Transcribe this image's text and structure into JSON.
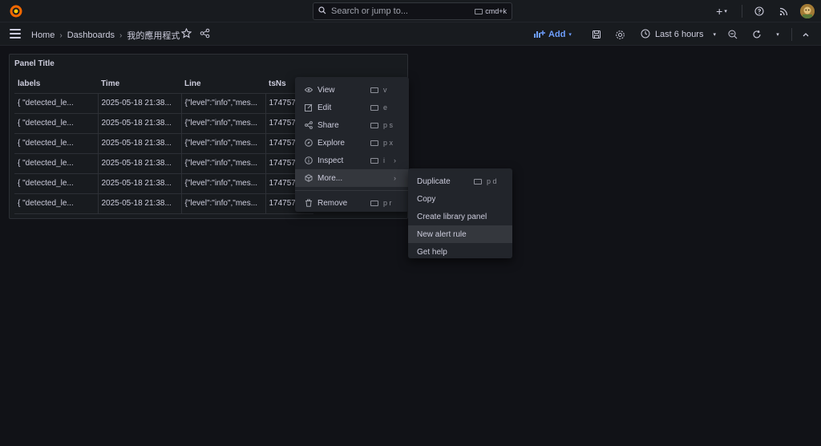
{
  "topbar": {
    "search_placeholder": "Search or jump to...",
    "search_shortcut": "cmd+k",
    "plus_label": "+"
  },
  "breadcrumb": {
    "home": "Home",
    "dashboards": "Dashboards",
    "current": "我的應用程式"
  },
  "toolbar": {
    "add_label": "Add",
    "time_range": "Last 6 hours"
  },
  "panel": {
    "title": "Panel Title",
    "columns": [
      "labels",
      "Time",
      "Line",
      "tsNs"
    ],
    "rows": [
      [
        "{ \"detected_le...",
        "2025-05-18 21:38...",
        "{\"level\":\"info\",\"mes...",
        "174757"
      ],
      [
        "{ \"detected_le...",
        "2025-05-18 21:38...",
        "{\"level\":\"info\",\"mes...",
        "174757"
      ],
      [
        "{ \"detected_le...",
        "2025-05-18 21:38...",
        "{\"level\":\"info\",\"mes...",
        "174757"
      ],
      [
        "{ \"detected_le...",
        "2025-05-18 21:38...",
        "{\"level\":\"info\",\"mes...",
        "174757"
      ],
      [
        "{ \"detected_le...",
        "2025-05-18 21:38...",
        "{\"level\":\"info\",\"mes...",
        "174757"
      ],
      [
        "{ \"detected_le...",
        "2025-05-18 21:38...",
        "{\"level\":\"info\",\"mes...",
        "174757"
      ]
    ]
  },
  "context_menu": {
    "items": [
      {
        "label": "View",
        "shortcut": "v",
        "icon": "eye-icon"
      },
      {
        "label": "Edit",
        "shortcut": "e",
        "icon": "edit-icon"
      },
      {
        "label": "Share",
        "shortcut": "p s",
        "icon": "share-icon"
      },
      {
        "label": "Explore",
        "shortcut": "p x",
        "icon": "compass-icon"
      },
      {
        "label": "Inspect",
        "shortcut": "i",
        "icon": "info-icon"
      },
      {
        "label": "More...",
        "shortcut": "",
        "icon": "cube-icon"
      },
      {
        "label": "Remove",
        "shortcut": "p r",
        "icon": "trash-icon"
      }
    ]
  },
  "submenu": {
    "items": [
      {
        "label": "Duplicate",
        "shortcut": "p d"
      },
      {
        "label": "Copy",
        "shortcut": ""
      },
      {
        "label": "Create library panel",
        "shortcut": ""
      },
      {
        "label": "New alert rule",
        "shortcut": ""
      },
      {
        "label": "Get help",
        "shortcut": ""
      }
    ]
  },
  "colors": {
    "background": "#111217",
    "bar": "#181b1f",
    "accent": "#6e9fff",
    "menu": "#22252b",
    "highlight": "#34373d"
  }
}
